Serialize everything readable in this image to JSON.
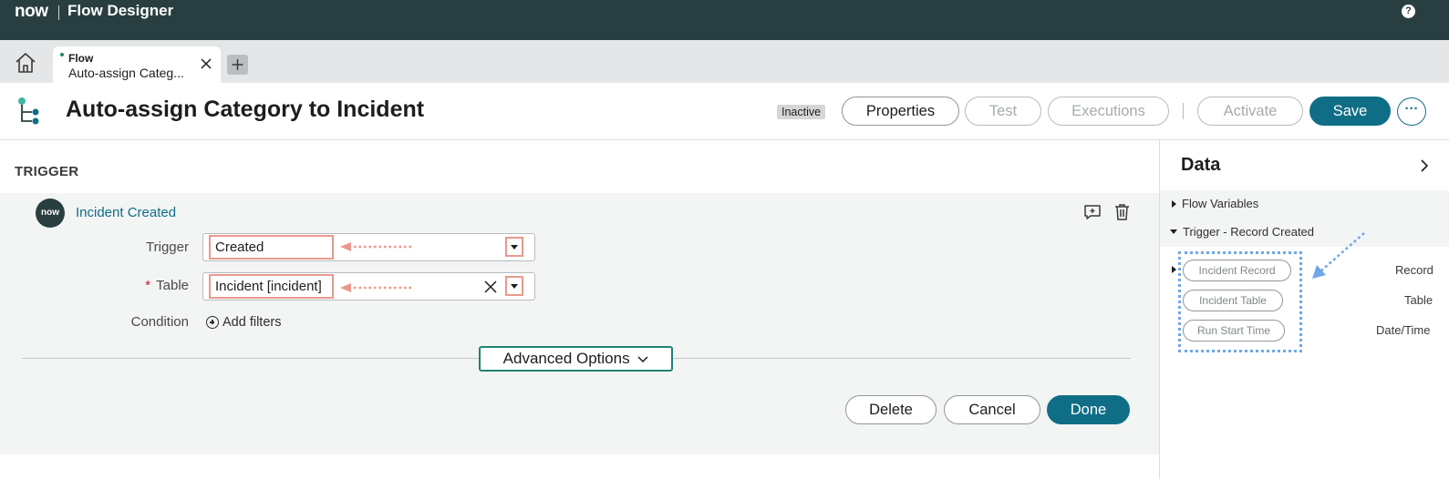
{
  "app": {
    "logo_text": "now",
    "title": "Flow Designer",
    "help_icon": "help-circle-icon"
  },
  "tabs": {
    "home_icon": "home-icon",
    "active": {
      "type": "Flow",
      "name": "Auto-assign Categ..."
    },
    "add_icon": "plus-icon"
  },
  "header": {
    "flow_icon": "flow-branch-icon",
    "title": "Auto-assign Category to Incident",
    "status": "Inactive",
    "properties_label": "Properties",
    "test_label": "Test",
    "executions_label": "Executions",
    "activate_label": "Activate",
    "save_label": "Save",
    "more_label": "···"
  },
  "trigger": {
    "section_label": "TRIGGER",
    "avatar_text": "now",
    "name": "Incident Created",
    "fields": {
      "trigger_label": "Trigger",
      "trigger_value": "Created",
      "table_required": "*",
      "table_label": "Table",
      "table_value": "Incident [incident]",
      "condition_label": "Condition",
      "add_filters": "Add filters"
    },
    "advanced_options": "Advanced Options",
    "delete_label": "Delete",
    "cancel_label": "Cancel",
    "done_label": "Done"
  },
  "data_panel": {
    "title": "Data",
    "flow_variables": "Flow Variables",
    "trigger_group": "Trigger - Record Created",
    "pills": [
      {
        "label": "Incident Record",
        "type": "Record"
      },
      {
        "label": "Incident Table",
        "type": "Table"
      },
      {
        "label": "Run Start Time",
        "type": "Date/Time"
      }
    ]
  },
  "colors": {
    "topbar": "#293e40",
    "primary": "#0f6e85",
    "annotation_red": "#e8998d",
    "annotation_blue": "#6ea8e8"
  }
}
